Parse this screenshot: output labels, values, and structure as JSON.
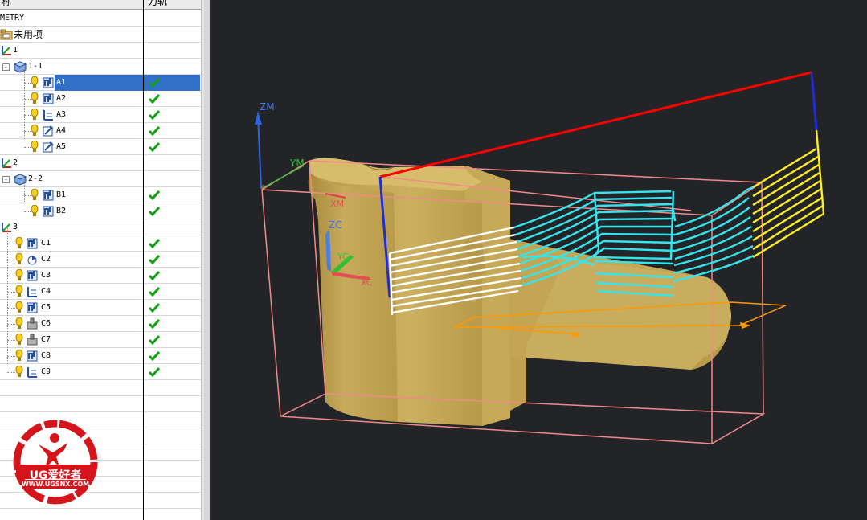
{
  "navigator": {
    "col_name_partial": "称",
    "col_path": "刀轨",
    "rows": [
      {
        "id": "geometry",
        "label": "METRY",
        "level": 0
      },
      {
        "id": "unused",
        "label": "未用项",
        "level": 0
      },
      {
        "id": "g1",
        "label": "1",
        "level": 0
      },
      {
        "id": "g1-1",
        "label": "1-1",
        "level": 1
      },
      {
        "id": "A1",
        "label": "A1",
        "level": 2,
        "ok": true,
        "selected": true
      },
      {
        "id": "A2",
        "label": "A2",
        "level": 2,
        "ok": true
      },
      {
        "id": "A3",
        "label": "A3",
        "level": 2,
        "ok": true
      },
      {
        "id": "A4",
        "label": "A4",
        "level": 2,
        "ok": true
      },
      {
        "id": "A5",
        "label": "A5",
        "level": 2,
        "ok": true
      },
      {
        "id": "g2",
        "label": "2",
        "level": 0
      },
      {
        "id": "g2-2",
        "label": "2-2",
        "level": 1
      },
      {
        "id": "B1",
        "label": "B1",
        "level": 2,
        "ok": true
      },
      {
        "id": "B2",
        "label": "B2",
        "level": 2,
        "ok": true
      },
      {
        "id": "g3",
        "label": "3",
        "level": 0
      },
      {
        "id": "C1",
        "label": "C1",
        "level": 1,
        "ok": true
      },
      {
        "id": "C2",
        "label": "C2",
        "level": 1,
        "ok": true
      },
      {
        "id": "C3",
        "label": "C3",
        "level": 1,
        "ok": true
      },
      {
        "id": "C4",
        "label": "C4",
        "level": 1,
        "ok": true
      },
      {
        "id": "C5",
        "label": "C5",
        "level": 1,
        "ok": true
      },
      {
        "id": "C6",
        "label": "C6",
        "level": 1,
        "ok": true
      },
      {
        "id": "C7",
        "label": "C7",
        "level": 1,
        "ok": true
      },
      {
        "id": "C8",
        "label": "C8",
        "level": 1,
        "ok": true
      },
      {
        "id": "C9",
        "label": "C9",
        "level": 1,
        "ok": true
      }
    ]
  },
  "viewport": {
    "axis_zm": "ZM",
    "axis_ym": "YM",
    "axis_xm": "XM",
    "axis_zc": "ZC",
    "axis_yc": "YC",
    "axis_xc": "XC",
    "colors": {
      "background": "#232428",
      "part": "#c8a850",
      "blank": "#f08080",
      "path_white": "#ffffff",
      "path_cyan": "#33e6ee",
      "path_yellow": "#ffee22",
      "rapid_red": "#ff0000",
      "engage_blue": "#0022dd",
      "orange": "#ff9900"
    }
  },
  "watermark": {
    "brand": "UG爱好者",
    "url": "WWW.UGSNX.COM"
  }
}
